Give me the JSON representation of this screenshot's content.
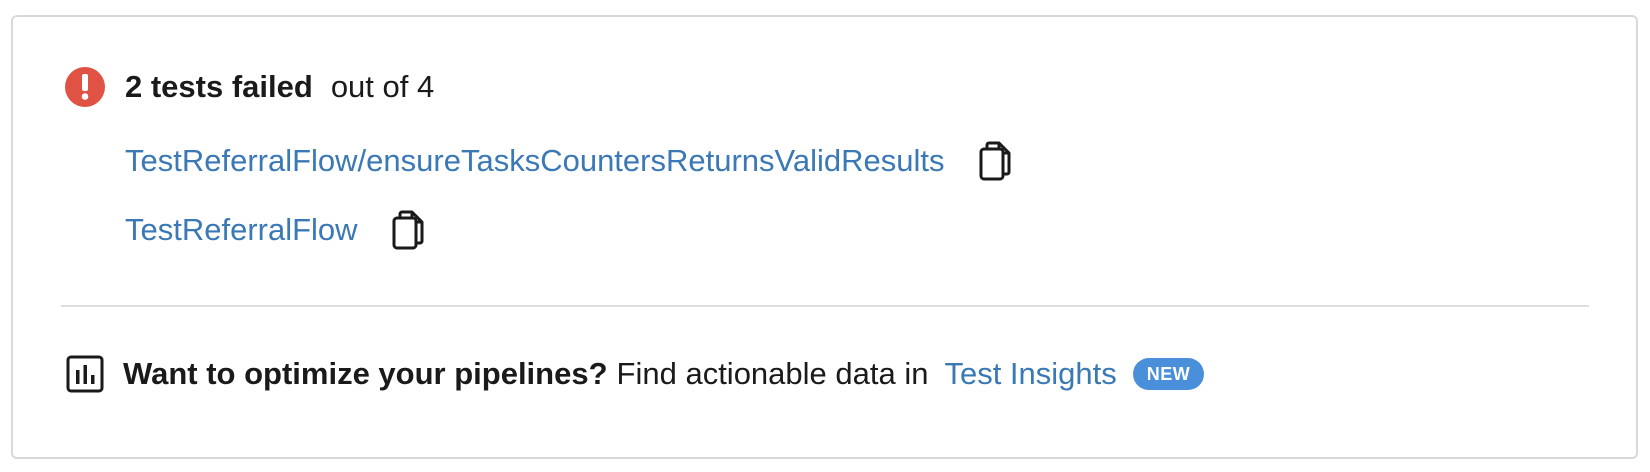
{
  "summary": {
    "failed_text": "2 tests failed",
    "total_text": "out of 4",
    "status_color": "#e05243"
  },
  "failed_tests": [
    {
      "name": "TestReferralFlow/ensureTasksCountersReturnsValidResults",
      "copy_icon": "copy-icon"
    },
    {
      "name": "TestReferralFlow",
      "copy_icon": "copy-icon"
    }
  ],
  "promo": {
    "icon": "bar-chart-icon",
    "headline": "Want to optimize your pipelines?",
    "text": "Find actionable data in",
    "link_label": "Test Insights",
    "badge": "NEW",
    "badge_color": "#4a8fd9",
    "link_color": "#3a78b6"
  }
}
